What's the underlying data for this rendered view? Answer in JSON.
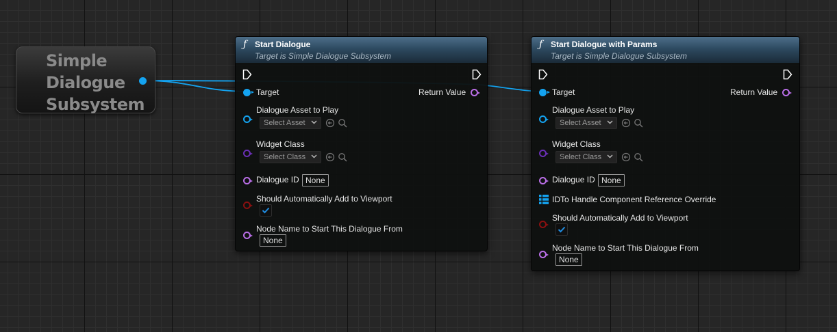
{
  "variable_node": {
    "title": "Simple Dialogue Subsystem"
  },
  "node1": {
    "icon": "function-icon",
    "title": "Start Dialogue",
    "subtitle": "Target is Simple Dialogue Subsystem",
    "target_label": "Target",
    "return_label": "Return Value",
    "dialogue_asset_label": "Dialogue Asset to Play",
    "dialogue_asset_value": "Select Asset",
    "widget_class_label": "Widget Class",
    "widget_class_value": "Select Class",
    "dialogue_id_label": "Dialogue ID",
    "dialogue_id_value": "None",
    "auto_add_label": "Should Automatically Add to Viewport",
    "auto_add_checked": true,
    "node_name_label": "Node Name to Start This Dialogue From",
    "node_name_value": "None"
  },
  "node2": {
    "icon": "function-icon",
    "title": "Start Dialogue with Params",
    "subtitle": "Target is Simple Dialogue Subsystem",
    "target_label": "Target",
    "return_label": "Return Value",
    "dialogue_asset_label": "Dialogue Asset to Play",
    "dialogue_asset_value": "Select Asset",
    "widget_class_label": "Widget Class",
    "widget_class_value": "Select Class",
    "dialogue_id_label": "Dialogue ID",
    "dialogue_id_value": "None",
    "id_handle_label": "IDTo Handle Component Reference Override",
    "auto_add_label": "Should Automatically Add to Viewport",
    "auto_add_checked": true,
    "node_name_label": "Node Name to Start This Dialogue From",
    "node_name_value": "None"
  },
  "colors": {
    "object_pin": "#14a3f0",
    "name_pin": "#b96ee6",
    "class_pin": "#6a2fb5",
    "bool_pin": "#8a1010",
    "header": "#2d4a61"
  }
}
